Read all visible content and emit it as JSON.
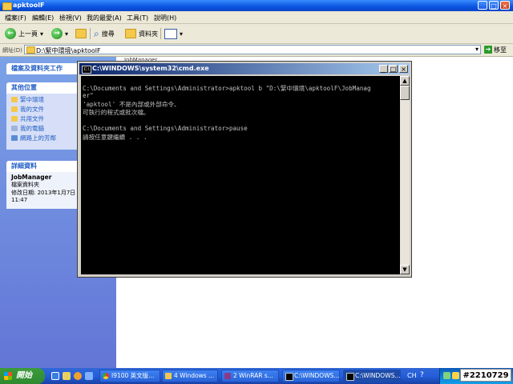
{
  "explorer": {
    "title": "apktoolF",
    "menu": [
      "檔案(F)",
      "編輯(E)",
      "檢視(V)",
      "我的最愛(A)",
      "工具(T)",
      "說明(H)"
    ],
    "toolbar": {
      "back": "上一頁",
      "search": "搜尋",
      "folders": "資料夾"
    },
    "address": {
      "label": "網址(D)",
      "value": "D:\\緊中環境\\apktoolF",
      "go": "移至"
    },
    "sidebar": {
      "tasks_title": "檔案及資料夾工作",
      "places_title": "其他位置",
      "places": [
        "緊中環境",
        "我的文件",
        "共用文件",
        "我的電腦",
        "網路上的芳鄰"
      ],
      "details_title": "詳細資料",
      "details": {
        "name": "JobManager",
        "type": "檔案資料夾",
        "modified": "修改日期: 2013年1月7日",
        "time": "11:47"
      }
    },
    "file_name": "JobManager"
  },
  "cmd": {
    "title": "C:\\WINDOWS\\system32\\cmd.exe",
    "lines": [
      "C:\\Documents and Settings\\Administrator>apktool b \"D:\\緊中環境\\apktoolF\\JobManag",
      "er\"",
      "'apktool' 不是內部或外部命令、",
      "可執行的程式或批次檔。",
      "",
      "C:\\Documents and Settings\\Administrator>pause",
      "請按任意鍵繼續 . . ."
    ]
  },
  "taskbar": {
    "start": "開始",
    "items": [
      "I9100 英文版...",
      "4 Windows ...",
      "2 WinRAR s...",
      "C:\\WINDOWS...",
      "C:\\WINDOWS..."
    ],
    "lang": "CH",
    "watermark": "#2210729"
  }
}
